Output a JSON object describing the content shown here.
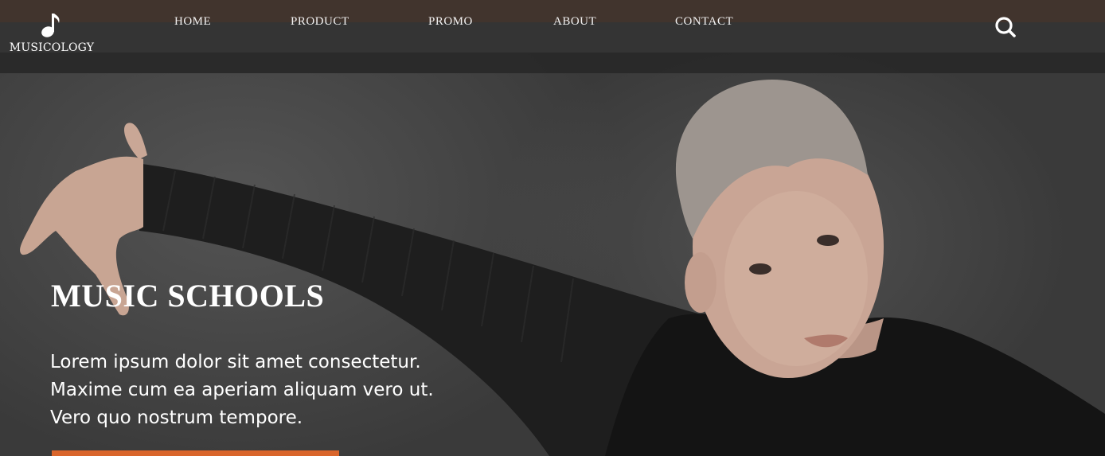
{
  "brand": {
    "logo_text": "MUSICOLOGY",
    "logo_icon": "music-note-icon"
  },
  "nav": {
    "items": [
      {
        "label": "HOME"
      },
      {
        "label": "PRODUCT"
      },
      {
        "label": "PROMO"
      },
      {
        "label": "ABOUT"
      },
      {
        "label": "CONTACT"
      }
    ],
    "search_icon": "search-icon"
  },
  "hero": {
    "title": "MUSIC SCHOOLS",
    "lines": [
      "Lorem ipsum dolor sit amet consectetur.",
      "Maxime cum ea aperiam aliquam vero ut.",
      "Vero quo nostrum tempore."
    ]
  },
  "colors": {
    "top_strip": "#41342d",
    "navbar": "#343434",
    "accent": "#d9652b",
    "text": "#ffffff"
  }
}
